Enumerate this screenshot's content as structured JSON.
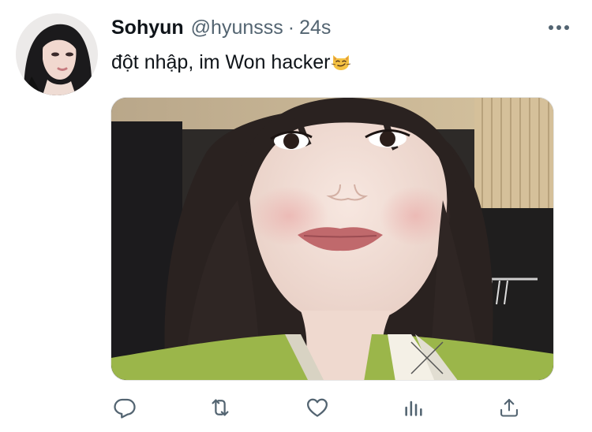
{
  "tweet": {
    "display_name": "Sohyun",
    "handle": "@hyunsss",
    "separator": "·",
    "time": "24s",
    "text": "đột nhập, im Won hacker",
    "text_emoji": "smirking-cat-face-emoji"
  },
  "icons": {
    "more": "more-horizontal-icon",
    "reply": "reply-icon",
    "retweet": "retweet-icon",
    "like": "heart-icon",
    "views": "analytics-icon",
    "share": "share-icon"
  },
  "colors": {
    "text": "#0f1419",
    "secondary": "#536471",
    "icon": "#536471",
    "sweater_green": "#9bb64a"
  }
}
